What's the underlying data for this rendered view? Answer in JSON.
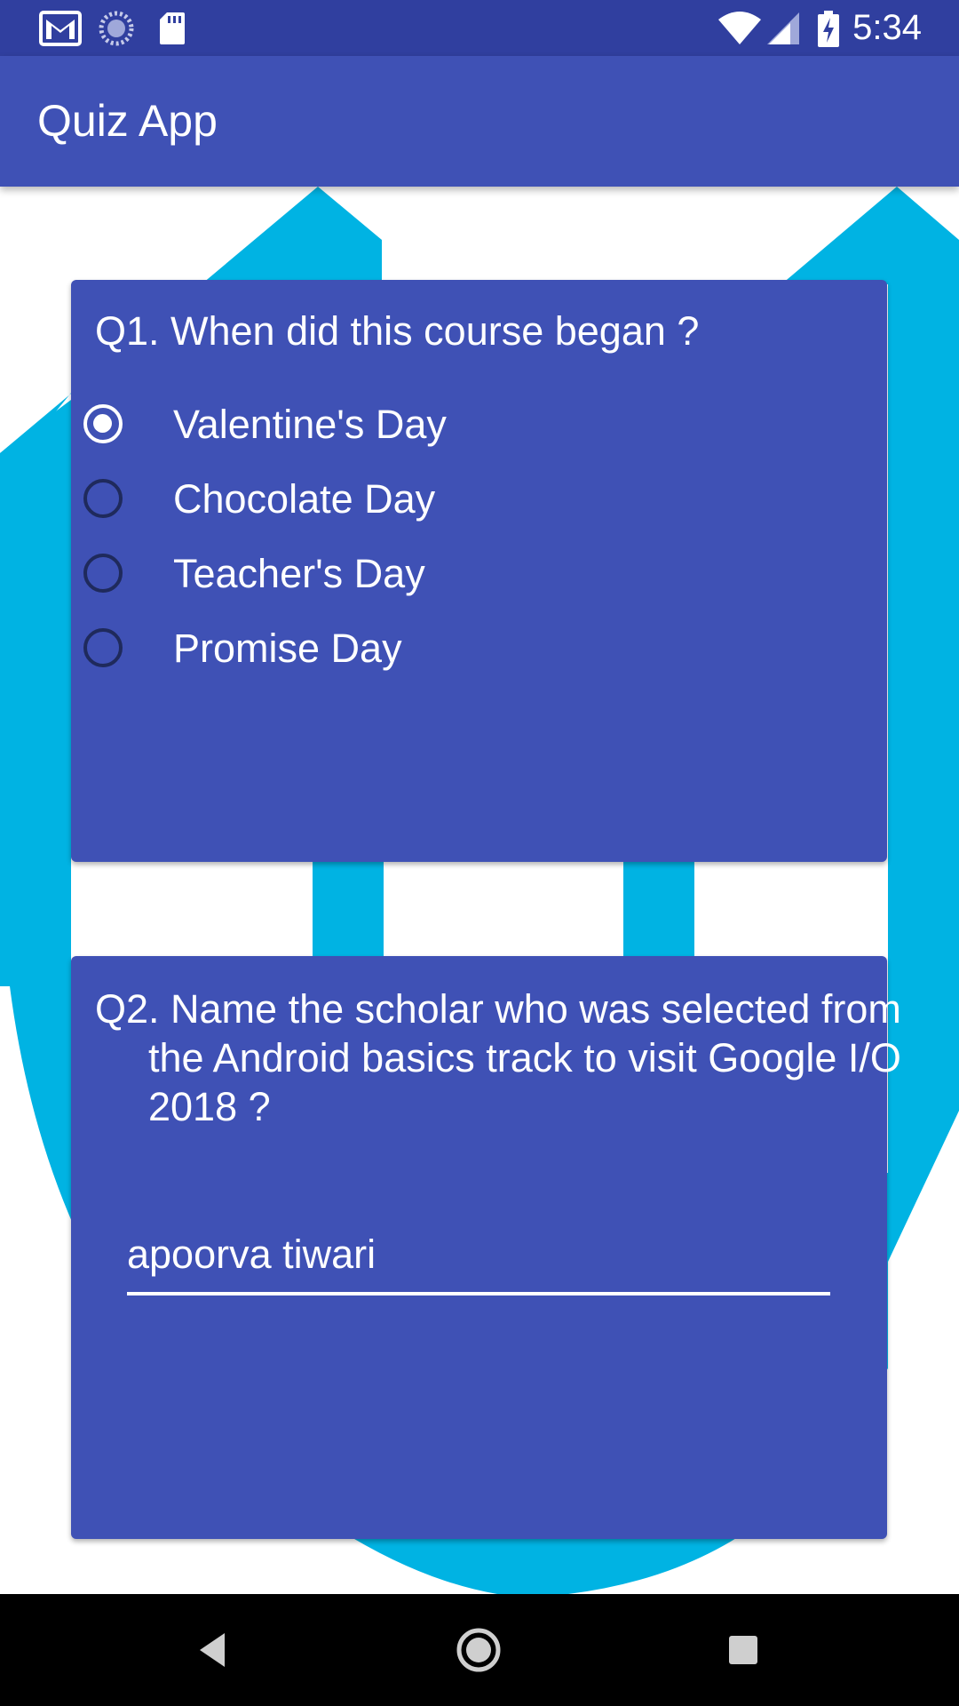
{
  "status_bar": {
    "time": "5:34",
    "icons": [
      "gmail-icon",
      "sync-icon",
      "sd-card-icon",
      "wifi-icon",
      "signal-icon",
      "battery-charging-icon"
    ]
  },
  "app_bar": {
    "title": "Quiz App"
  },
  "questions": {
    "q1": {
      "text": "Q1. When did this course began ?",
      "options": [
        {
          "label": "Valentine's Day",
          "checked": true
        },
        {
          "label": "Chocolate Day",
          "checked": false
        },
        {
          "label": "Teacher's Day",
          "checked": false
        },
        {
          "label": "Promise Day",
          "checked": false
        }
      ]
    },
    "q2": {
      "text": "Q2. Name the scholar who was selected from the Android basics track to visit Google I/O 2018 ?",
      "answer_value": "apoorva tiwari"
    }
  },
  "nav_bar": {
    "buttons": [
      "back-icon",
      "home-icon",
      "recents-icon"
    ]
  },
  "colors": {
    "status_bar": "#303f9f",
    "primary": "#3f51b5",
    "accent_art": "#00b3e3",
    "nav_bar": "#000000"
  }
}
